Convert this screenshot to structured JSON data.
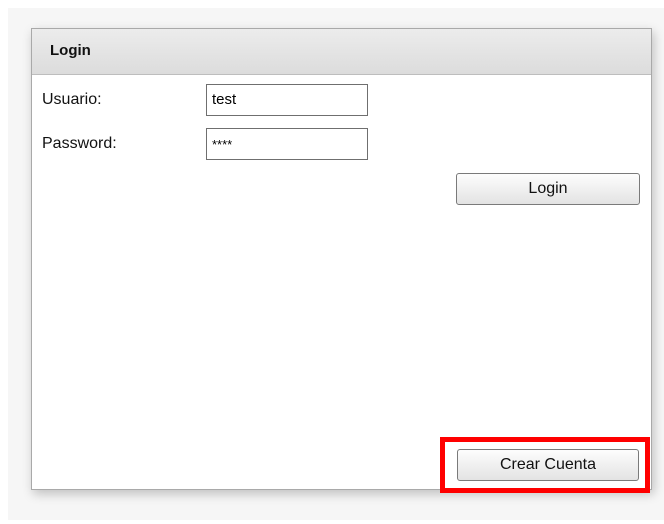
{
  "login": {
    "title": "Login",
    "username_label": "Usuario:",
    "username_value": "test",
    "password_label": "Password:",
    "password_value": "****",
    "login_button": "Login",
    "create_account_button": "Crear Cuenta"
  },
  "colors": {
    "highlight": "#ff0000",
    "header_bg": "#e2e2e2"
  }
}
